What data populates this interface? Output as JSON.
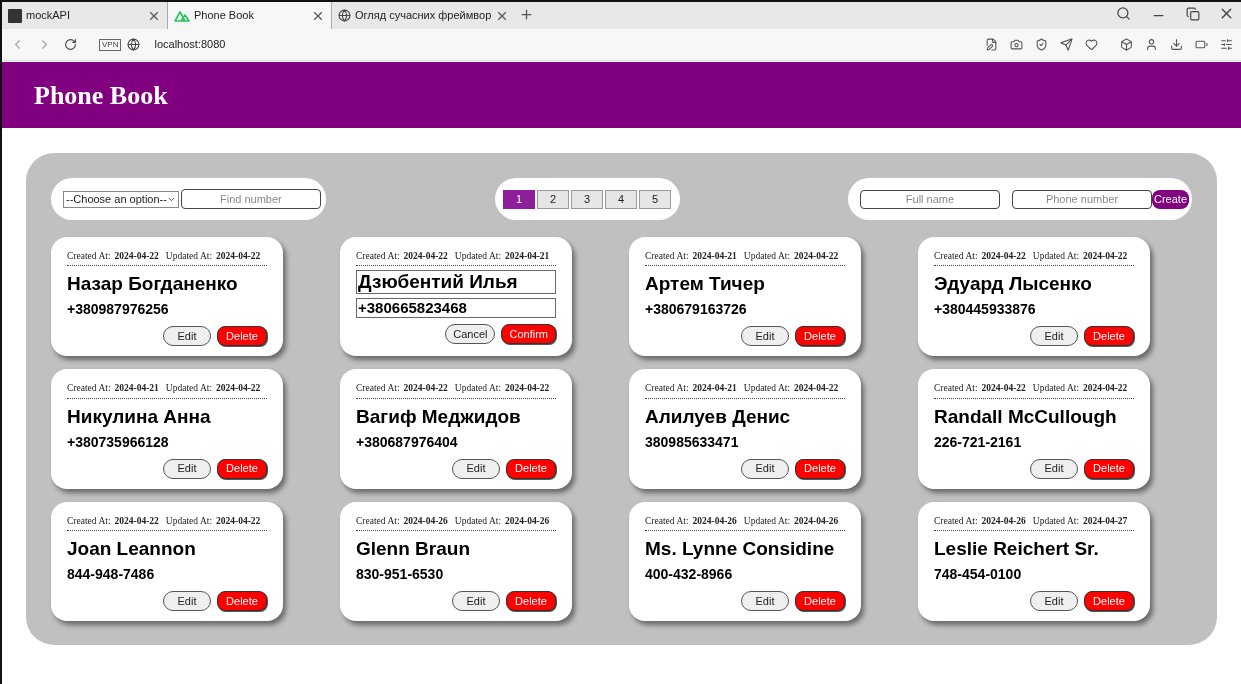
{
  "browser": {
    "tabs": [
      {
        "title": "mockAPI",
        "selected": false,
        "kind": "api"
      },
      {
        "title": "Phone Book",
        "selected": true,
        "kind": "logo"
      },
      {
        "title": "Огляд сучасних фреймвор",
        "selected": false,
        "kind": "globe"
      }
    ],
    "vpn": "VPN",
    "address": "localhost:8080"
  },
  "header": {
    "title": "Phone Book"
  },
  "filter": {
    "select": "--Choose an option--",
    "search_placeholder": "Find number"
  },
  "pagination": [
    {
      "label": "1",
      "selected": true
    },
    {
      "label": "2",
      "selected": false
    },
    {
      "label": "3",
      "selected": false
    },
    {
      "label": "4",
      "selected": false
    },
    {
      "label": "5",
      "selected": false
    }
  ],
  "create_form": {
    "name_placeholder": "Full name",
    "phone_placeholder": "Phone number",
    "button": "Create"
  },
  "contacts": [
    {
      "kind": "view",
      "created_label": "Created At:",
      "created": "2024-04-22",
      "updated_label": "Updated At:",
      "updated": "2024-04-22",
      "name": "Назар Богданенко",
      "phone": "+380987976256",
      "actions": [
        "Edit",
        "Delete"
      ]
    },
    {
      "kind": "editing",
      "created_label": "Created At:",
      "created": "2024-04-22",
      "updated_label": "Updated At:",
      "updated": "2024-04-21",
      "name": "Дзюбентий Илья",
      "phone": "+380665823468",
      "actions": [
        "Cancel",
        "Confirm"
      ]
    },
    {
      "kind": "view",
      "created_label": "Created At:",
      "created": "2024-04-21",
      "updated_label": "Updated At:",
      "updated": "2024-04-22",
      "name": "Артем Тичер",
      "phone": "+380679163726",
      "actions": [
        "Edit",
        "Delete"
      ]
    },
    {
      "kind": "view",
      "created_label": "Created At:",
      "created": "2024-04-22",
      "updated_label": "Updated At:",
      "updated": "2024-04-22",
      "name": "Эдуард Лысенко",
      "phone": "+380445933876",
      "actions": [
        "Edit",
        "Delete"
      ]
    },
    {
      "kind": "view",
      "created_label": "Created At:",
      "created": "2024-04-21",
      "updated_label": "Updated At:",
      "updated": "2024-04-22",
      "name": "Никулина Анна",
      "phone": "+380735966128",
      "actions": [
        "Edit",
        "Delete"
      ]
    },
    {
      "kind": "view",
      "created_label": "Created At:",
      "created": "2024-04-22",
      "updated_label": "Updated At:",
      "updated": "2024-04-22",
      "name": "Вагиф Меджидов",
      "phone": "+380687976404",
      "actions": [
        "Edit",
        "Delete"
      ]
    },
    {
      "kind": "view",
      "created_label": "Created At:",
      "created": "2024-04-21",
      "updated_label": "Updated At:",
      "updated": "2024-04-22",
      "name": "Алилуев Денис",
      "phone": "380985633471",
      "actions": [
        "Edit",
        "Delete"
      ]
    },
    {
      "kind": "view",
      "created_label": "Created At:",
      "created": "2024-04-22",
      "updated_label": "Updated At:",
      "updated": "2024-04-22",
      "name": "Randall McCullough",
      "phone": "226-721-2161",
      "actions": [
        "Edit",
        "Delete"
      ]
    },
    {
      "kind": "view",
      "created_label": "Created At:",
      "created": "2024-04-22",
      "updated_label": "Updated At:",
      "updated": "2024-04-22",
      "name": "Joan Leannon",
      "phone": "844-948-7486",
      "actions": [
        "Edit",
        "Delete"
      ]
    },
    {
      "kind": "view",
      "created_label": "Created At:",
      "created": "2024-04-26",
      "updated_label": "Updated At:",
      "updated": "2024-04-26",
      "name": "Glenn Braun",
      "phone": "830-951-6530",
      "actions": [
        "Edit",
        "Delete"
      ]
    },
    {
      "kind": "view",
      "created_label": "Created At:",
      "created": "2024-04-26",
      "updated_label": "Updated At:",
      "updated": "2024-04-26",
      "name": "Ms. Lynne Considine",
      "phone": "400-432-8966",
      "actions": [
        "Edit",
        "Delete"
      ]
    },
    {
      "kind": "view",
      "created_label": "Created At:",
      "created": "2024-04-26",
      "updated_label": "Updated At:",
      "updated": "2024-04-27",
      "name": "Leslie Reichert Sr.",
      "phone": "748-454-0100",
      "actions": [
        "Edit",
        "Delete"
      ]
    }
  ]
}
